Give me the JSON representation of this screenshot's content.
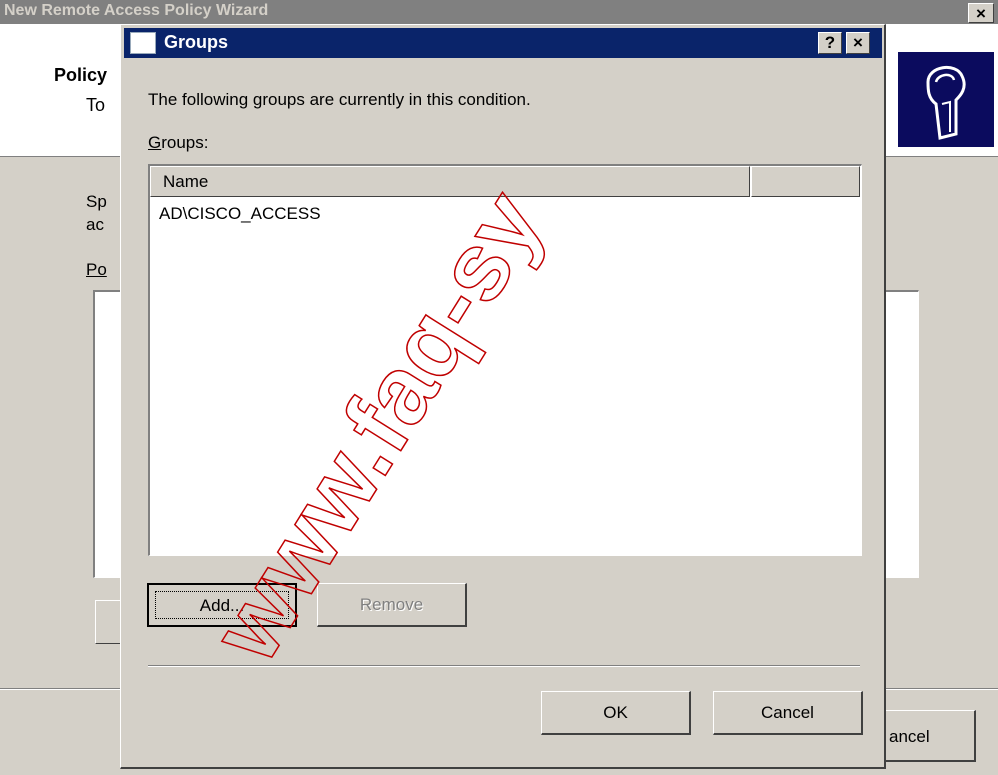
{
  "wizard": {
    "title": "New Remote Access Policy Wizard",
    "close_label": "×",
    "header_title": "Policy",
    "header_subtitle": "To",
    "body_line1": "Sp",
    "body_line2": "ac",
    "body_label": "Po",
    "cancel_label": "ancel"
  },
  "dialog": {
    "title": "Groups",
    "help_label": "?",
    "close_label": "×",
    "description": "The following groups are currently in this condition.",
    "groups_label_hotkey": "G",
    "groups_label_rest": "roups:",
    "list": {
      "columns": [
        "Name",
        ""
      ],
      "rows": [
        "AD\\CISCO_ACCESS"
      ]
    },
    "add_button": "Add...",
    "remove_button": "Remove",
    "ok_button": "OK",
    "cancel_button": "Cancel"
  },
  "watermark": "www.faq-sy",
  "colors": {
    "titlebar_active": "#0a246a",
    "titlebar_inactive": "#808080",
    "face": "#d4d0c8",
    "logo_bg": "#0b0b5e"
  }
}
